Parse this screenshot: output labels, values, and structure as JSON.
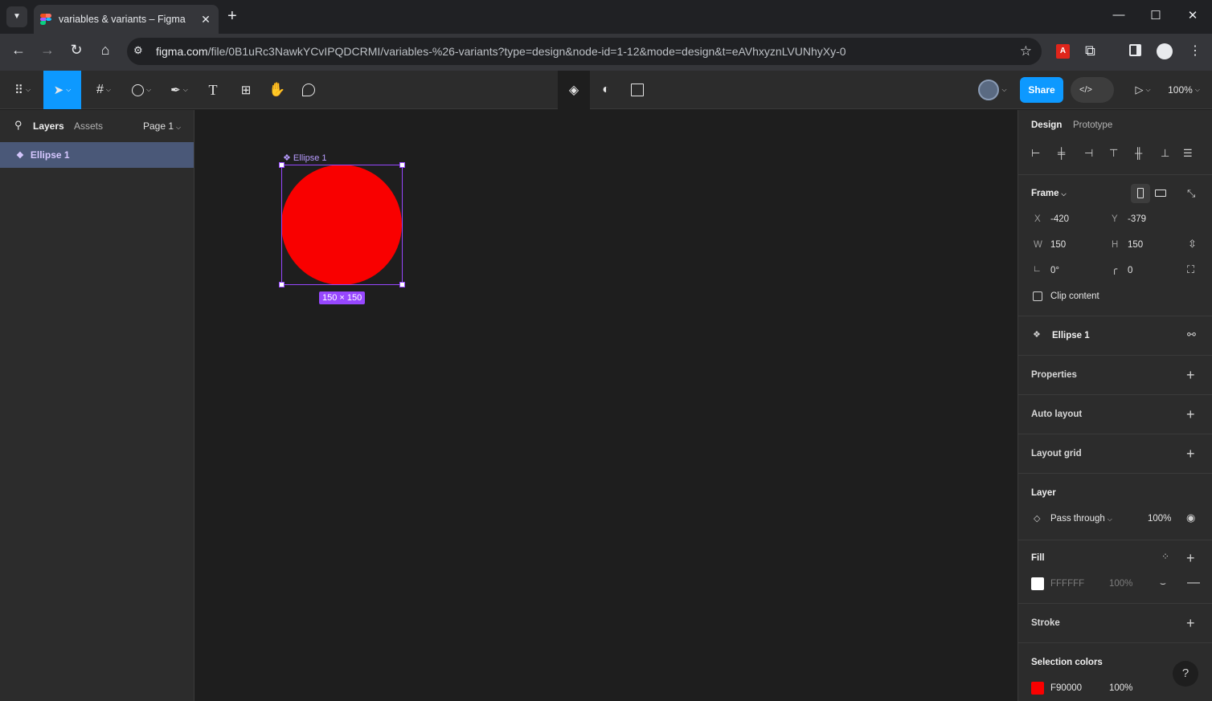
{
  "browser": {
    "tab_title": "variables & variants – Figma",
    "url_host": "figma.com",
    "url_path": "/file/0B1uRc3NawkYCvIPQDCRMI/variables-%26-variants?type=design&node-id=1-12&mode=design&t=eAVhxyznLVUNhyXy-0"
  },
  "toolbar": {
    "share_label": "Share",
    "zoom": "100%"
  },
  "left_panel": {
    "tabs": [
      "Layers",
      "Assets"
    ],
    "page": "Page 1",
    "layers": [
      "Ellipse 1"
    ]
  },
  "canvas": {
    "label": "Ellipse 1",
    "dimensions": "150 × 150",
    "fill_color": "#f90000"
  },
  "right_panel": {
    "tabs": [
      "Design",
      "Prototype"
    ],
    "frame": {
      "title": "Frame",
      "x_label": "X",
      "x": "-420",
      "y_label": "Y",
      "y": "-379",
      "w_label": "W",
      "w": "150",
      "h_label": "H",
      "h": "150",
      "rotation": "0°",
      "radius": "0",
      "clip_label": "Clip content"
    },
    "component_name": "Ellipse 1",
    "sections": {
      "properties": "Properties",
      "auto_layout": "Auto layout",
      "layout_grid": "Layout grid",
      "layer": "Layer",
      "fill": "Fill",
      "stroke": "Stroke",
      "selection_colors": "Selection colors"
    },
    "layer": {
      "blend": "Pass through",
      "opacity": "100%"
    },
    "fill": {
      "hex": "FFFFFF",
      "opacity": "100%",
      "color": "#ffffff"
    },
    "selection_color": {
      "hex": "F90000",
      "opacity": "100%",
      "color": "#f90000"
    },
    "help": "?"
  }
}
